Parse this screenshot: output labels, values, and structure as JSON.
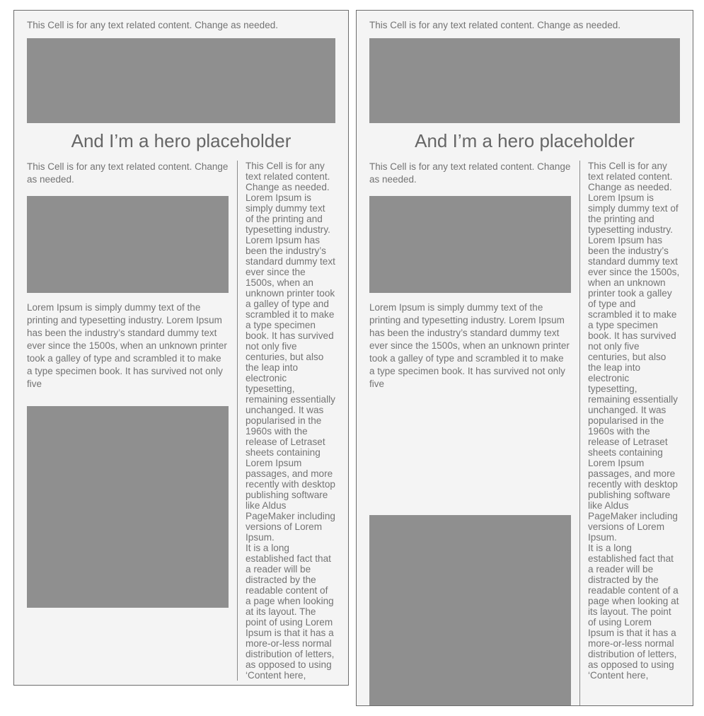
{
  "page": {
    "background_color": "#ffffff",
    "panel_background_color": "#f4f4f4",
    "panel_border_color": "#6d6d6d",
    "placeholder_color": "#8f8f8f",
    "text_color": "#737373",
    "heading_color": "#666666"
  },
  "panels": [
    {
      "id": "left-panel",
      "top_lede": "This Cell is for any text related content. Change as needed.",
      "hero_image_alt": "hero-placeholder-image",
      "hero_title": "And I’m a hero placeholder",
      "main_column": {
        "lede": "This Cell is for any text related content. Change as needed.",
        "mid_image_alt": "content-placeholder-image",
        "body": "Lorem Ipsum is simply dummy text of the printing and typesetting industry. Lorem Ipsum has been the industry’s standard dummy text ever since the 1500s, when an unknown printer took a galley of type and scrambled it to make a type specimen book. It has survived not only five",
        "lower_image_alt": "content-placeholder-image"
      },
      "rail_column": {
        "paragraph_1": "This Cell is for any text related content. Change as needed. Lorem Ipsum is simply dummy text of the printing and typesetting industry. Lorem Ipsum has been the industry’s standard dummy text ever since the 1500s, when an unknown printer took a galley of type and scrambled it to make a type specimen book. It has survived not only five centuries, but also the leap into electronic typesetting, remaining essentially unchanged. It was popularised in the 1960s with the release of Letraset sheets containing Lorem Ipsum passages, and more recently with desktop publishing software like Aldus PageMaker including versions of Lorem Ipsum.",
        "paragraph_2": "It is a long established fact that a reader will be distracted by the readable content of a page when looking at its layout. The point of using Lorem Ipsum is that it has a more-or-less normal distribution of letters, as opposed to using ‘Content here,"
      }
    },
    {
      "id": "right-panel",
      "top_lede": "This Cell is for any text related content. Change as needed.",
      "hero_image_alt": "hero-placeholder-image",
      "hero_title": "And I’m a hero placeholder",
      "main_column": {
        "lede": "This Cell is for any text related content. Change as needed.",
        "mid_image_alt": "content-placeholder-image",
        "body": "Lorem Ipsum is simply dummy text of the printing and typesetting industry. Lorem Ipsum has been the industry’s standard dummy text ever since the 1500s, when an unknown printer took a galley of type and scrambled it to make a type specimen book. It has survived not only five",
        "lower_image_alt": "content-placeholder-image"
      },
      "rail_column": {
        "paragraph_1": "This Cell is for any text related content. Change as needed. Lorem Ipsum is simply dummy text of the printing and typesetting industry. Lorem Ipsum has been the industry’s standard dummy text ever since the 1500s, when an unknown printer took a galley of type and scrambled it to make a type specimen book. It has survived not only five centuries, but also the leap into electronic typesetting, remaining essentially unchanged. It was popularised in the 1960s with the release of Letraset sheets containing Lorem Ipsum passages, and more recently with desktop publishing software like Aldus PageMaker including versions of Lorem Ipsum.",
        "paragraph_2": "It is a long established fact that a reader will be distracted by the readable content of a page when looking at its layout. The point of using Lorem Ipsum is that it has a more-or-less normal distribution of letters, as opposed to using ‘Content here,"
      }
    }
  ]
}
